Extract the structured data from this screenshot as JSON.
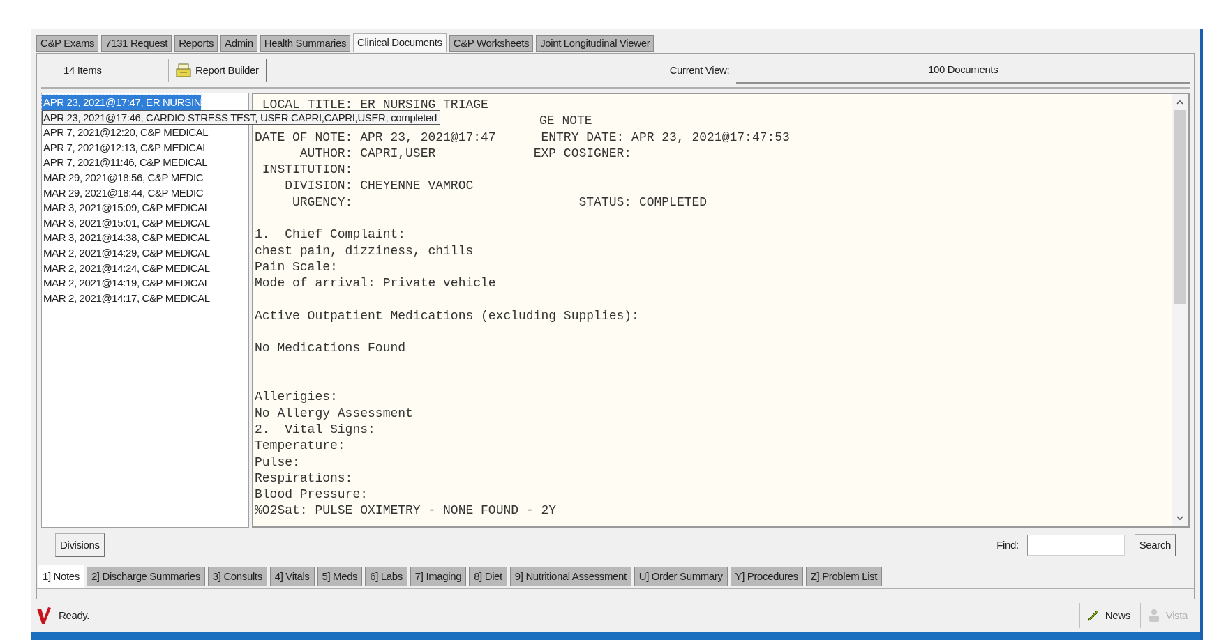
{
  "top_tabs": [
    {
      "label": "C&P Exams",
      "selected": false
    },
    {
      "label": "7131 Request",
      "selected": false
    },
    {
      "label": "Reports",
      "selected": false
    },
    {
      "label": "Admin",
      "selected": false
    },
    {
      "label": "Health Summaries",
      "selected": false
    },
    {
      "label": "Clinical Documents",
      "selected": true
    },
    {
      "label": "C&P Worksheets",
      "selected": false
    },
    {
      "label": "Joint Longitudinal Viewer",
      "selected": false
    }
  ],
  "toolbar": {
    "item_count": "14 Items",
    "report_builder": "Report Builder",
    "current_view_label": "Current View:",
    "current_view": "100 Documents"
  },
  "notes_list": {
    "items": [
      {
        "kind": "row",
        "text": "APR 23, 2021@17:47, ER NURSIN",
        "selected": true
      },
      {
        "kind": "hint",
        "text": "APR 23, 2021@17:46, CARDIO STRESS TEST, USER CAPRI,CAPRI,USER, completed",
        "selected": false
      },
      {
        "kind": "row",
        "text": "APR 7, 2021@12:20, C&P MEDICAL",
        "selected": false
      },
      {
        "kind": "row",
        "text": "APR 7, 2021@12:13, C&P MEDICAL",
        "selected": false
      },
      {
        "kind": "row",
        "text": "APR 7, 2021@11:46, C&P MEDICAL",
        "selected": false
      },
      {
        "kind": "row",
        "text": "MAR 29, 2021@18:56, C&P MEDIC",
        "selected": false
      },
      {
        "kind": "row",
        "text": "MAR 29, 2021@18:44, C&P MEDIC",
        "selected": false
      },
      {
        "kind": "row",
        "text": "MAR 3, 2021@15:09, C&P MEDICAL",
        "selected": false
      },
      {
        "kind": "row",
        "text": "MAR 3, 2021@15:01, C&P MEDICAL",
        "selected": false
      },
      {
        "kind": "row",
        "text": "MAR 3, 2021@14:38, C&P MEDICAL",
        "selected": false
      },
      {
        "kind": "row",
        "text": "MAR 2, 2021@14:29, C&P MEDICAL",
        "selected": false
      },
      {
        "kind": "row",
        "text": "MAR 2, 2021@14:24, C&P MEDICAL",
        "selected": false
      },
      {
        "kind": "row",
        "text": "MAR 2, 2021@14:19, C&P MEDICAL",
        "selected": false
      },
      {
        "kind": "row",
        "text": "MAR 2, 2021@14:17, C&P MEDICAL",
        "selected": false
      }
    ]
  },
  "document": {
    "lines": [
      {
        "kind": "text",
        "text": " LOCAL TITLE: ER NURSING TRIAGE"
      },
      {
        "kind": "partial",
        "text": "GE NOTE"
      },
      {
        "kind": "text",
        "text": "DATE OF NOTE: APR 23, 2021@17:47      ENTRY DATE: APR 23, 2021@17:47:53"
      },
      {
        "kind": "text",
        "text": "      AUTHOR: CAPRI,USER             EXP COSIGNER:"
      },
      {
        "kind": "text",
        "text": " INSTITUTION:"
      },
      {
        "kind": "text",
        "text": "    DIVISION: CHEYENNE VAMROC"
      },
      {
        "kind": "text",
        "text": "     URGENCY:                              STATUS: COMPLETED"
      },
      {
        "kind": "blank"
      },
      {
        "kind": "text",
        "text": "1.  Chief Complaint:"
      },
      {
        "kind": "text",
        "text": "chest pain, dizziness, chills"
      },
      {
        "kind": "text",
        "text": "Pain Scale:"
      },
      {
        "kind": "text",
        "text": "Mode of arrival: Private vehicle"
      },
      {
        "kind": "blank"
      },
      {
        "kind": "text",
        "text": "Active Outpatient Medications (excluding Supplies):"
      },
      {
        "kind": "blank"
      },
      {
        "kind": "text",
        "text": "No Medications Found"
      },
      {
        "kind": "blank"
      },
      {
        "kind": "blank"
      },
      {
        "kind": "text",
        "text": "Allerigies:"
      },
      {
        "kind": "text",
        "text": "No Allergy Assessment"
      },
      {
        "kind": "text",
        "text": "2.  Vital Signs:"
      },
      {
        "kind": "text",
        "text": "Temperature:"
      },
      {
        "kind": "text",
        "text": "Pulse:"
      },
      {
        "kind": "text",
        "text": "Respirations:"
      },
      {
        "kind": "text",
        "text": "Blood Pressure:"
      },
      {
        "kind": "text",
        "text": "%O2Sat: PULSE OXIMETRY - NONE FOUND - 2Y"
      }
    ]
  },
  "footer": {
    "divisions": "Divisions",
    "find_label": "Find:",
    "search": "Search"
  },
  "bottom_tabs": [
    {
      "label": "1] Notes",
      "selected": true
    },
    {
      "label": "2] Discharge Summaries",
      "selected": false
    },
    {
      "label": "3] Consults",
      "selected": false
    },
    {
      "label": "4] Vitals",
      "selected": false
    },
    {
      "label": "5] Meds",
      "selected": false
    },
    {
      "label": "6] Labs",
      "selected": false
    },
    {
      "label": "7] Imaging",
      "selected": false
    },
    {
      "label": "8] Diet",
      "selected": false
    },
    {
      "label": "9] Nutritional Assessment",
      "selected": false
    },
    {
      "label": "U] Order Summary",
      "selected": false
    },
    {
      "label": "Y] Procedures",
      "selected": false
    },
    {
      "label": "Z] Problem List",
      "selected": false
    }
  ],
  "status_bar": {
    "text": "Ready.",
    "buttons": [
      {
        "kind": "news",
        "label": "News",
        "disabled": false
      },
      {
        "kind": "vista",
        "label": "Vista",
        "disabled": true
      }
    ]
  }
}
